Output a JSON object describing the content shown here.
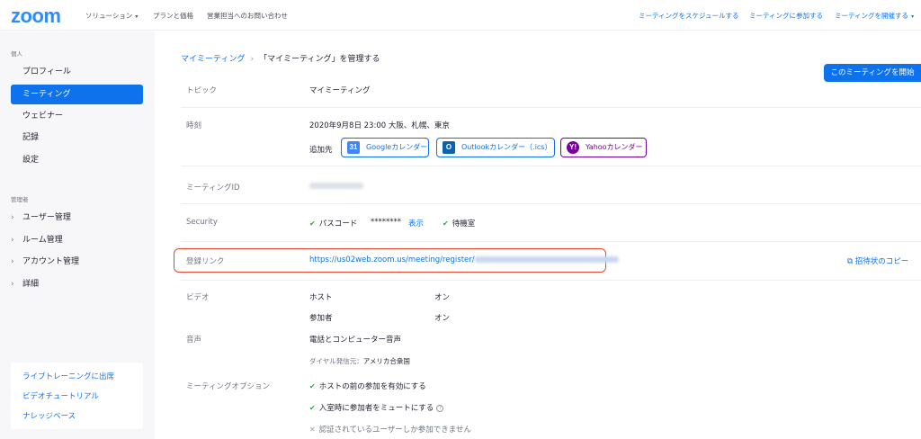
{
  "brand": {
    "logo": "zoom",
    "accent": "#0e72ed"
  },
  "topnav": {
    "left": [
      "ソリューション",
      "プランと価格",
      "営業担当へのお問い合わせ"
    ],
    "right": [
      "ミーティングをスケジュールする",
      "ミーティングに参加する",
      "ミーティングを開催する"
    ]
  },
  "sidebar": {
    "personal_label": "個人",
    "personal_items": [
      "プロフィール",
      "ミーティング",
      "ウェビナー",
      "記録",
      "設定"
    ],
    "admin_label": "管理者",
    "admin_items": [
      "ユーザー管理",
      "ルーム管理",
      "アカウント管理",
      "詳細"
    ],
    "resources": [
      "ライブトレーニングに出席",
      "ビデオチュートリアル",
      "ナレッジベース"
    ]
  },
  "breadcrumb": {
    "parent": "マイミーティング",
    "sep": "›",
    "current": "「マイミーティング」を管理する"
  },
  "start_button": "このミーティングを開始",
  "details": {
    "topic_label": "トピック",
    "topic": "マイミーティング",
    "time_label": "時刻",
    "time": "2020年9月8日 23:00 大阪、札幌、東京",
    "add_to_label": "追加先",
    "calendars": [
      {
        "label": "Googleカレンダー",
        "icon": "google-calendar-icon",
        "glyph": "31"
      },
      {
        "label": "Outlookカレンダー（.ics）",
        "icon": "outlook-icon",
        "glyph": "O"
      },
      {
        "label": "Yahooカレンダー",
        "icon": "yahoo-icon",
        "glyph": "Y!"
      }
    ],
    "meeting_id_label": "ミーティングID",
    "security_label": "Security",
    "passcode_label": "パスコード",
    "passcode_value": "********",
    "show_label": "表示",
    "waiting_room_label": "待機室",
    "registration_label": "登録リンク",
    "registration_url": "https://us02web.zoom.us/meeting/register/",
    "copy_invite": "招待状のコピー",
    "video_label": "ビデオ",
    "host_label": "ホスト",
    "host_value": "オン",
    "participant_label": "参加者",
    "participant_value": "オン",
    "audio_label": "音声",
    "audio_value": "電話とコンピューター音声",
    "dial_from_label": "ダイヤル発信元：",
    "dial_from_value": "アメリカ合衆国",
    "options_label": "ミーティングオプション",
    "options": [
      {
        "label": "ホストの前の参加を有効にする",
        "enabled": true
      },
      {
        "label": "入室時に参加者をミュートにする",
        "enabled": true
      },
      {
        "label": "認証されているユーザーしか参加できません",
        "enabled": false
      }
    ]
  }
}
